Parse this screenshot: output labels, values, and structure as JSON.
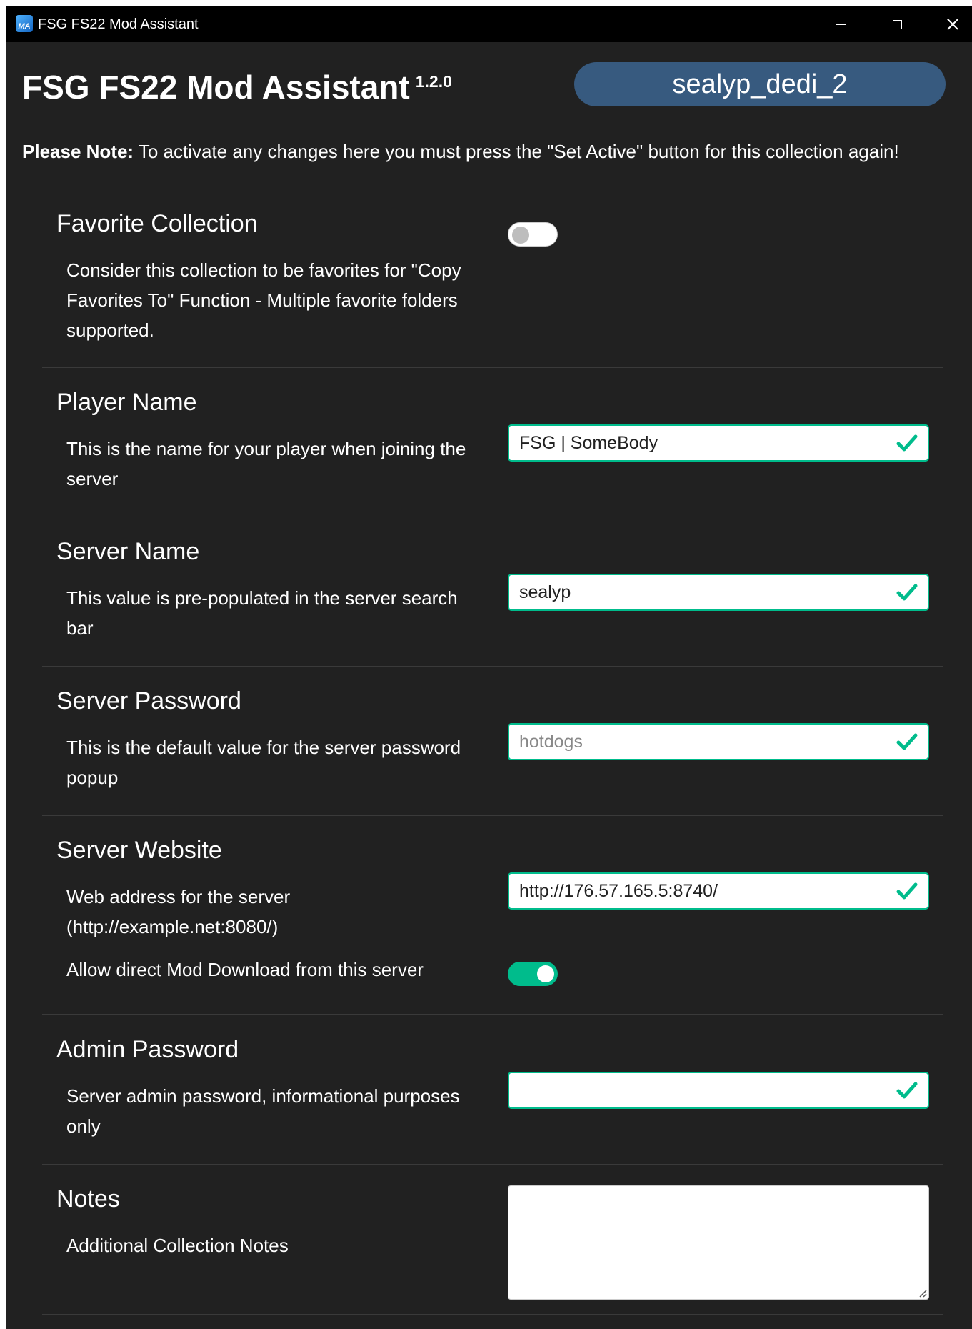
{
  "window": {
    "title": "FSG FS22 Mod Assistant",
    "icon_text": "MA",
    "controls": {
      "minimize": "minimize",
      "maximize": "maximize",
      "close": "close"
    }
  },
  "header": {
    "title": "FSG FS22 Mod Assistant",
    "version": "1.2.0",
    "collection_name": "sealyp_dedi_2",
    "note_label": "Please Note:",
    "note_text": " To activate any changes here you must press the \"Set Active\" button for this collection again!"
  },
  "settings": {
    "favorite": {
      "title": "Favorite Collection",
      "description": "Consider this collection to be favorites for \"Copy Favorites To\" Function - Multiple favorite folders supported.",
      "enabled": false
    },
    "player_name": {
      "title": "Player Name",
      "description": "This is the name for your player when joining the server",
      "value": "FSG | SomeBody"
    },
    "server_name": {
      "title": "Server Name",
      "description": "This value is pre-populated in the server search bar",
      "value": "sealyp"
    },
    "server_password": {
      "title": "Server Password",
      "description": "This is the default value for the server password popup",
      "value": "hotdogs"
    },
    "server_website": {
      "title": "Server Website",
      "description": "Web address for the server (http://example.net:8080/)",
      "value": "http://176.57.165.5:8740/",
      "download_label": "Allow direct Mod Download from this server",
      "download_enabled": true
    },
    "admin_password": {
      "title": "Admin Password",
      "description": "Server admin password, informational purposes only",
      "value": ""
    },
    "notes": {
      "title": "Notes",
      "description": "Additional Collection Notes",
      "value": ""
    }
  },
  "colors": {
    "background": "#212121",
    "accent": "#00bc8c",
    "pill": "#375a7f"
  }
}
